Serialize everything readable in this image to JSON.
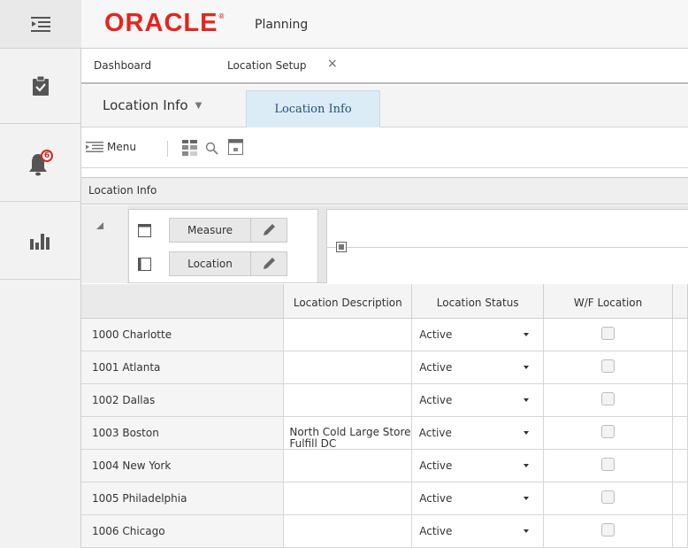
{
  "app": {
    "brand": "ORACLE",
    "brand_mark": "®",
    "product": "Planning"
  },
  "rail": {
    "items": [
      {
        "name": "navigator",
        "icon": "hamburger-menu-icon"
      },
      {
        "name": "tasks",
        "icon": "clipboard-check-icon"
      },
      {
        "name": "notifications",
        "icon": "bell-icon",
        "badge": "6"
      },
      {
        "name": "reports",
        "icon": "bar-chart-icon"
      }
    ]
  },
  "tabs": [
    {
      "label": "Dashboard"
    },
    {
      "label": "Location Setup",
      "close": "×"
    }
  ],
  "view": {
    "select_label": "Location Info",
    "caret": "▼",
    "active_label": "Location Info"
  },
  "toolbar": {
    "menu_label": "Menu"
  },
  "panel": {
    "title": "Location Info"
  },
  "pivot": {
    "rows": [
      {
        "label": "Measure"
      },
      {
        "label": "Location"
      }
    ]
  },
  "grid": {
    "columns": [
      "",
      "Location Description",
      "Location Status",
      "W/F Location"
    ],
    "rows": [
      {
        "name": "1000 Charlotte",
        "desc": "",
        "status": "Active",
        "wf": false
      },
      {
        "name": "1001 Atlanta",
        "desc": "",
        "status": "Active",
        "wf": false
      },
      {
        "name": "1002 Dallas",
        "desc": "",
        "status": "Active",
        "wf": false
      },
      {
        "name": "1003 Boston",
        "desc": "North Cold Large Store Fulfill DC",
        "status": "Active",
        "wf": false
      },
      {
        "name": "1004 New York",
        "desc": "",
        "status": "Active",
        "wf": false
      },
      {
        "name": "1005 Philadelphia",
        "desc": "",
        "status": "Active",
        "wf": false
      },
      {
        "name": "1006 Chicago",
        "desc": "",
        "status": "Active",
        "wf": false
      }
    ]
  },
  "colors": {
    "brand_red": "#e8231b",
    "active_tab_bg": "#dcecf7",
    "active_tab_text": "#1a4f87",
    "badge_red": "#d9251c"
  }
}
